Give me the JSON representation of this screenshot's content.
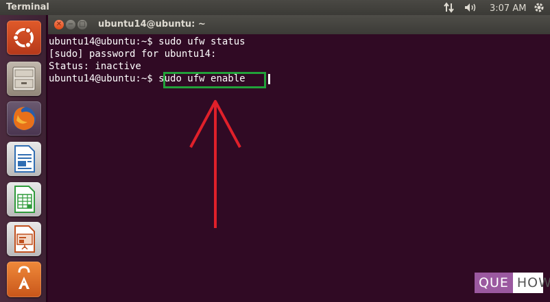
{
  "top_panel": {
    "app_title": "Terminal",
    "clock": "3:07 AM",
    "icons": [
      "network-icon",
      "volume-icon",
      "gear-icon"
    ]
  },
  "launcher": {
    "items": [
      {
        "name": "dash-home",
        "icon": "ubuntu-logo-icon",
        "active": false
      },
      {
        "name": "files",
        "icon": "file-cabinet-icon",
        "active": false
      },
      {
        "name": "firefox",
        "icon": "firefox-icon",
        "active": false
      },
      {
        "name": "libreoffice-writer",
        "icon": "writer-document-icon",
        "active": false
      },
      {
        "name": "libreoffice-calc",
        "icon": "calc-spreadsheet-icon",
        "active": false
      },
      {
        "name": "libreoffice-impress",
        "icon": "impress-presentation-icon",
        "active": false
      },
      {
        "name": "software-center",
        "icon": "shopping-bag-icon",
        "active": false
      }
    ]
  },
  "terminal": {
    "window_title": "ubuntu14@ubuntu: ~",
    "lines": [
      "ubuntu14@ubuntu:~$ sudo ufw status",
      "[sudo] password for ubuntu14:",
      "Status: inactive"
    ],
    "prompt": "ubuntu14@ubuntu:~$ ",
    "current_command": "sudo ufw enable",
    "colors": {
      "background": "#300a24",
      "text": "#ffffff",
      "highlight": "#22a13a",
      "arrow": "#e0202a"
    }
  },
  "watermark": {
    "part1": "QUE",
    "part2": "HOW"
  }
}
